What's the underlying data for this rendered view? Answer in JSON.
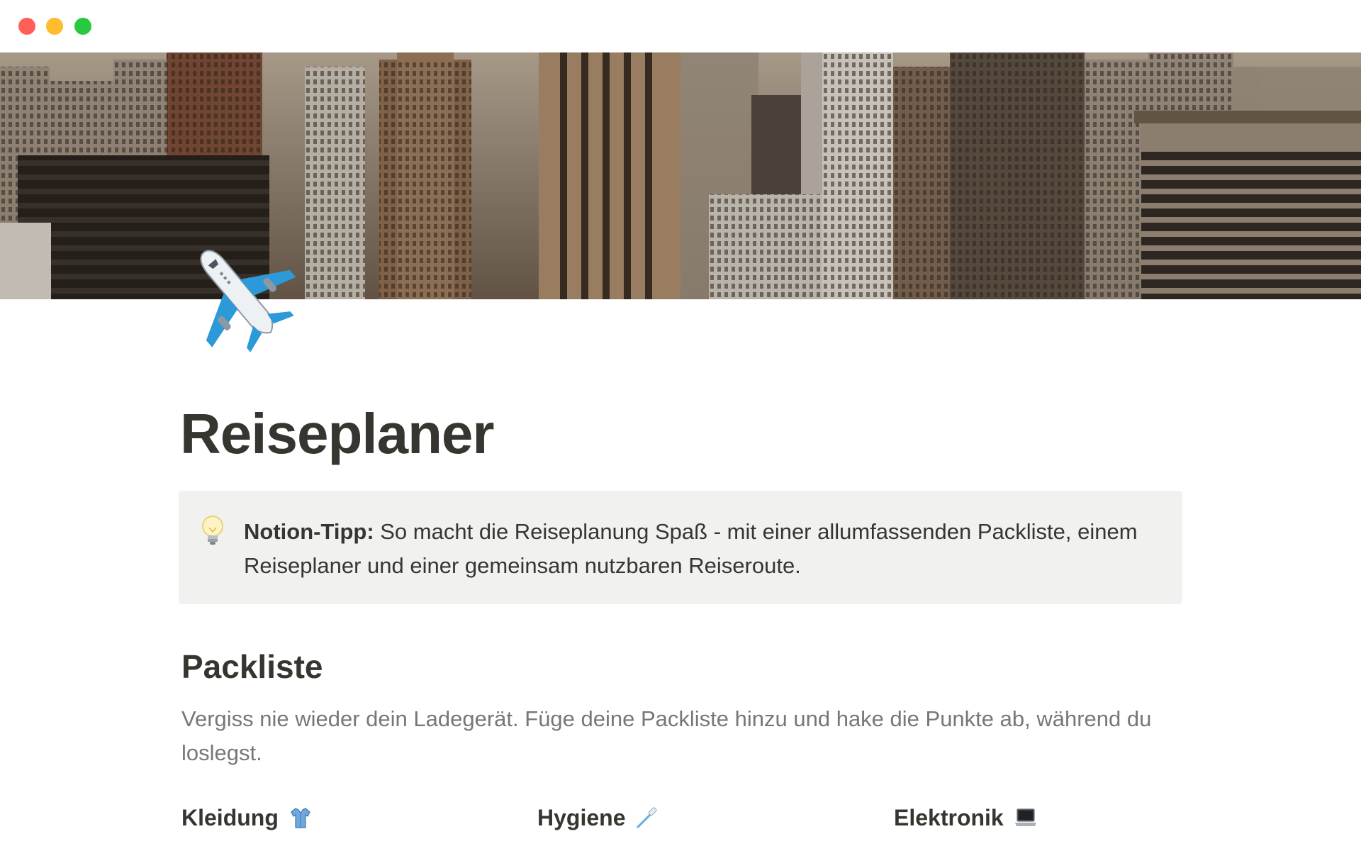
{
  "window": {
    "controls": {
      "close_color": "#ff5f57",
      "minimize_color": "#febc2e",
      "maximize_color": "#28c840"
    }
  },
  "cover": {
    "description_icon": "city-skyline-cover"
  },
  "page": {
    "icon": "airplane-icon",
    "title": "Reiseplaner"
  },
  "callout": {
    "icon": "lightbulb-icon",
    "bold_label": "Notion-Tipp:",
    "text": " So macht die Reiseplanung Spaß - mit einer allumfassenden Packliste, einem Reiseplaner und einer gemeinsam nutzbaren Reiseroute.",
    "background": "#f1f1ef"
  },
  "packliste": {
    "heading": "Packliste",
    "description": "Vergiss nie wieder dein Ladegerät. Füge deine Packliste hinzu und hake die Punkte ab, während du loslegst.",
    "columns": [
      {
        "label": "Kleidung",
        "icon": "shirt-icon"
      },
      {
        "label": "Hygiene",
        "icon": "toothbrush-icon"
      },
      {
        "label": "Elektronik",
        "icon": "laptop-icon"
      }
    ]
  },
  "colors": {
    "text": "#37352f",
    "muted_text": "#787774"
  }
}
